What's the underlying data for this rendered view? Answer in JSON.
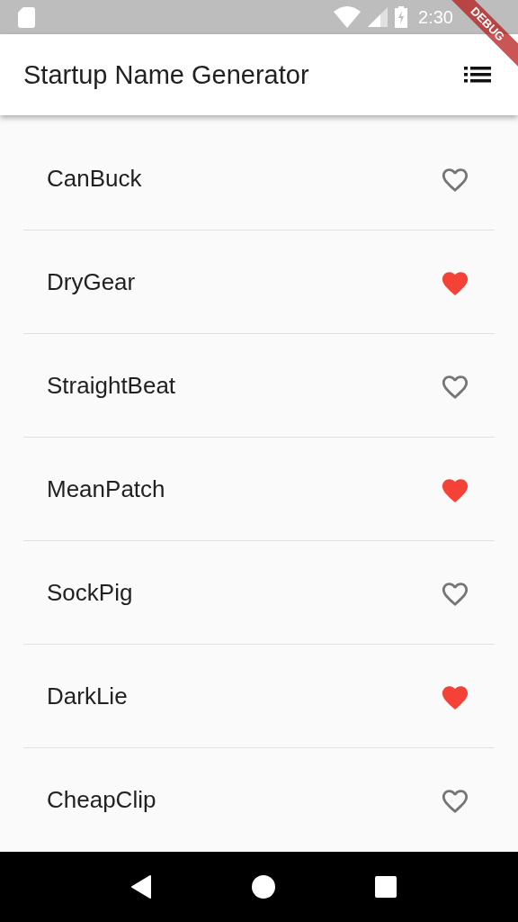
{
  "status_bar": {
    "time": "2:30"
  },
  "debug_banner": {
    "label": "DEBUG"
  },
  "app_bar": {
    "title": "Startup Name Generator"
  },
  "names": [
    {
      "name": "CanBuck",
      "saved": false
    },
    {
      "name": "DryGear",
      "saved": true
    },
    {
      "name": "StraightBeat",
      "saved": false
    },
    {
      "name": "MeanPatch",
      "saved": true
    },
    {
      "name": "SockPig",
      "saved": false
    },
    {
      "name": "DarkLie",
      "saved": true
    },
    {
      "name": "CheapClip",
      "saved": false
    }
  ]
}
